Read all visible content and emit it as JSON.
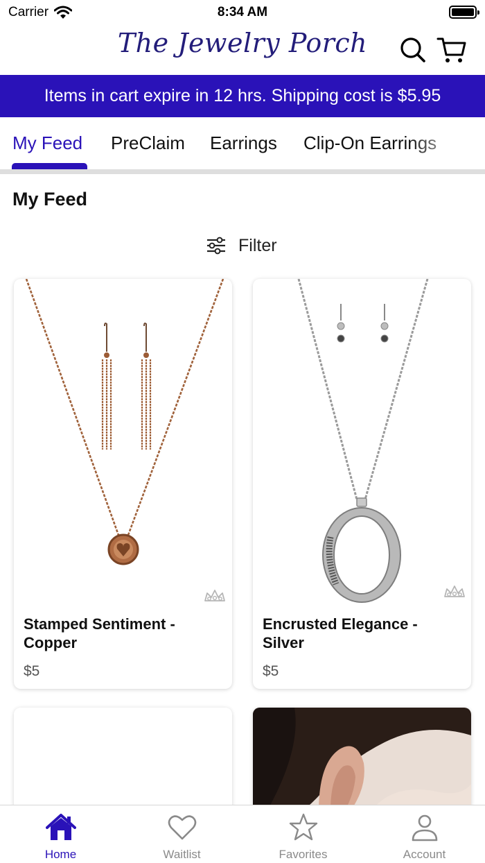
{
  "status_bar": {
    "carrier": "Carrier",
    "time": "8:34 AM"
  },
  "header": {
    "logo": "The Jewelry Porch"
  },
  "banner": {
    "text": "Items in cart expire in 12 hrs. Shipping cost is $5.95"
  },
  "tabs": [
    {
      "label": "My Feed"
    },
    {
      "label": "PreClaim"
    },
    {
      "label": "Earrings"
    },
    {
      "label": "Clip-On Earrings"
    }
  ],
  "feed": {
    "title": "My Feed",
    "filter_label": "Filter",
    "products": [
      {
        "name": "Stamped Sentiment - Copper",
        "price": "$5"
      },
      {
        "name": "Encrusted Elegance - Silver",
        "price": "$5"
      }
    ]
  },
  "tabbar": {
    "items": [
      {
        "label": "Home",
        "icon": "home-icon"
      },
      {
        "label": "Waitlist",
        "icon": "heart-icon"
      },
      {
        "label": "Favorites",
        "icon": "star-icon"
      },
      {
        "label": "Account",
        "icon": "person-icon"
      }
    ]
  },
  "colors": {
    "accent": "#2a12b8",
    "logo": "#231d7a",
    "copper": "#a0623b",
    "silver": "#8d8d8d"
  }
}
